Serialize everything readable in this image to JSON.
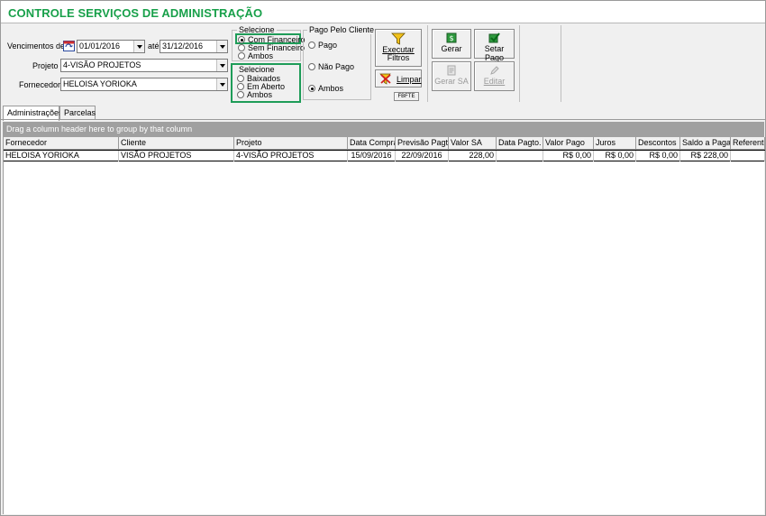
{
  "app": {
    "title": "CONTROLE SERVIÇOS DE ADMINISTRAÇÃO"
  },
  "filters": {
    "vencimentos_label": "Vencimentos de",
    "date_from": "01/01/2016",
    "ate_label": "até",
    "date_to": "31/12/2016",
    "projeto_label": "Projeto",
    "projeto_value": "4-VISÃO PROJETOS",
    "fornecedor_label": "Fornecedor",
    "fornecedor_value": "HELOISA YORIOKA"
  },
  "financeiro_group": {
    "title": "Selecione",
    "options": [
      "Com Financeiro",
      "Sem Financeiro",
      "Ambos"
    ],
    "selected": "Com Financeiro"
  },
  "baixa_group": {
    "title": "Selecione",
    "options": [
      "Baixados",
      "Em Aberto",
      "Ambos"
    ]
  },
  "pago_cliente_group": {
    "title": "Pago Pelo Cliente",
    "options": [
      "Pago",
      "Não Pago",
      "Ambos"
    ],
    "selected": "Ambos"
  },
  "buttons": {
    "executar_line1": "Executar",
    "executar_line2": "Filtros",
    "limpar": "Limpar",
    "small_tag": "FBFTE",
    "gerar": "Gerar",
    "setar_pago": "Setar Pago",
    "gerar_sa": "Gerar SA",
    "editar": "Editar"
  },
  "tabs": [
    "Administrações",
    "Parcelas"
  ],
  "grid": {
    "group_hint": "Drag a column header here to group by that column",
    "columns": [
      "Fornecedor",
      "Cliente",
      "Projeto",
      "Data Compra",
      "Previsão Pagto",
      "Valor SA",
      "Data Pagto.",
      "Valor Pago",
      "Juros",
      "Descontos",
      "Saldo a Pagar",
      "Referente"
    ],
    "rows": [
      [
        "HELOISA YORIOKA",
        "VISÃO PROJETOS",
        "4-VISÃO PROJETOS",
        "15/09/2016",
        "22/09/2016",
        "228,00",
        "",
        "R$ 0,00",
        "R$ 0,00",
        "R$ 0,00",
        "R$ 228,00",
        ""
      ]
    ]
  },
  "colors": {
    "title_green": "#18a04a",
    "highlight_green": "#1e9c58",
    "group_panel": "#a0a0a0"
  }
}
